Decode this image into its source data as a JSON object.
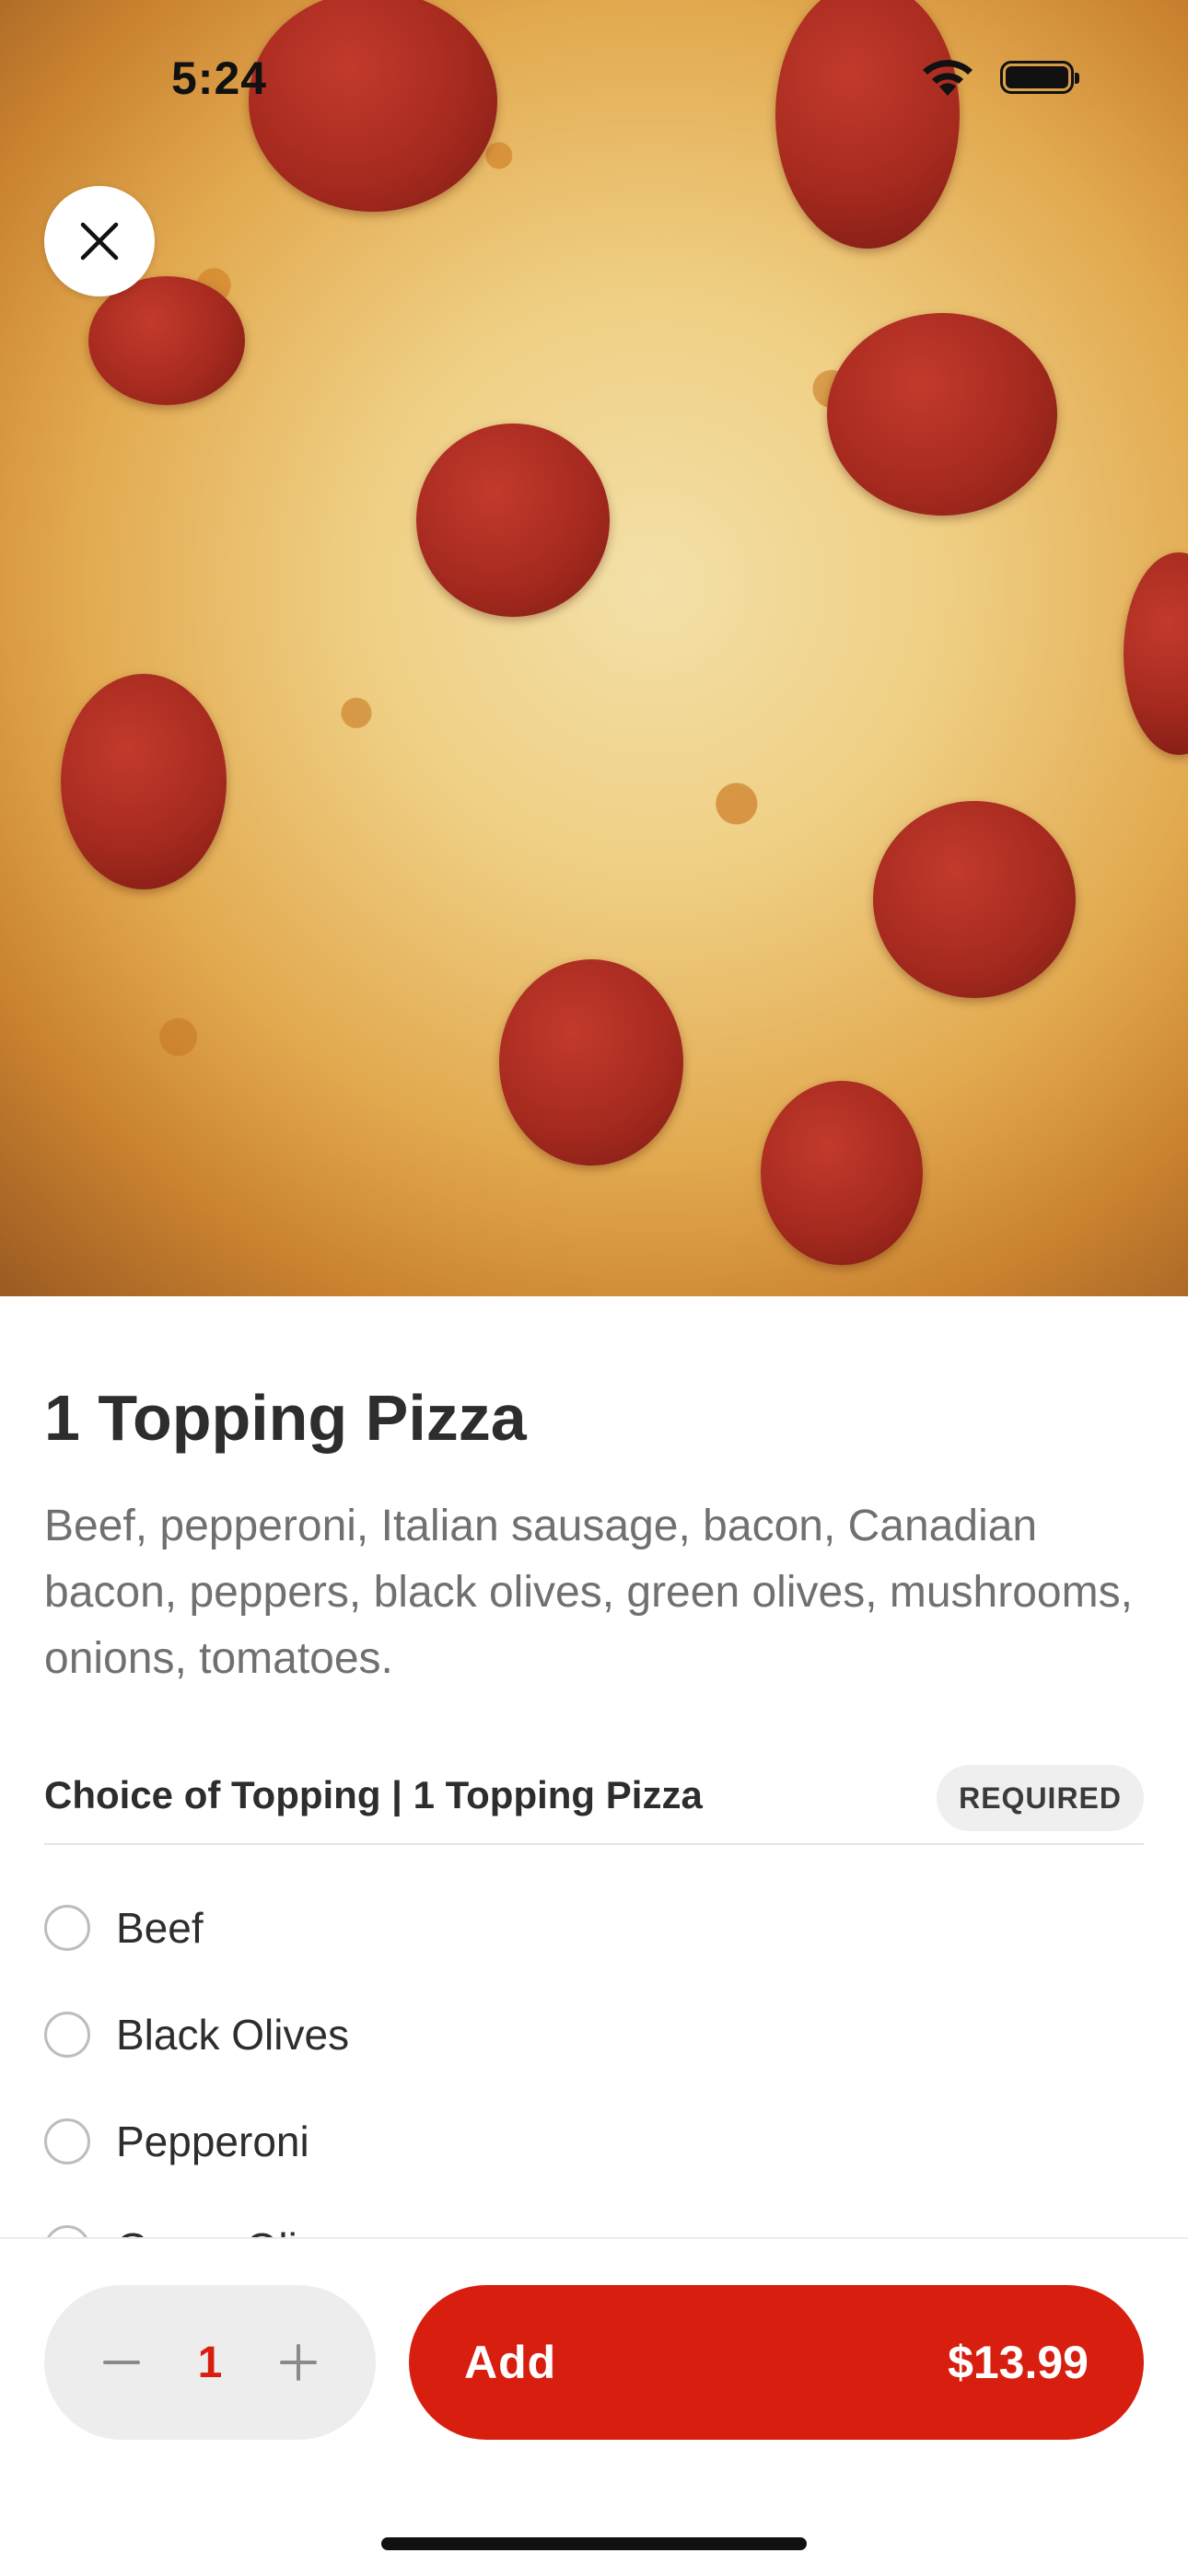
{
  "status_bar": {
    "time": "5:24",
    "wifi_icon": "wifi-icon",
    "battery_icon": "battery-icon"
  },
  "hero": {
    "close_icon": "close-icon"
  },
  "item": {
    "title": "1 Topping Pizza",
    "description": "Beef, pepperoni, Italian sausage, bacon, Canadian bacon, peppers, black olives, green olives, mushrooms, onions, tomatoes."
  },
  "option_group": {
    "title": "Choice of Topping | 1 Topping Pizza",
    "badge": "REQUIRED",
    "options": [
      {
        "label": "Beef",
        "selected": false
      },
      {
        "label": "Black Olives",
        "selected": false
      },
      {
        "label": "Pepperoni",
        "selected": false
      },
      {
        "label": "Green Oli",
        "selected": false
      }
    ]
  },
  "bottom_bar": {
    "quantity": "1",
    "add_label": "Add",
    "price": "$13.99",
    "accent_color": "#d71e0f"
  }
}
